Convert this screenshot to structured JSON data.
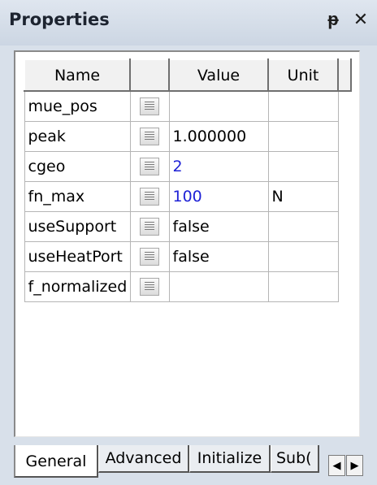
{
  "panel": {
    "title": "Properties",
    "pin_icon": "pin-icon",
    "close_icon": "close-icon",
    "pin_glyph": "ᵽ",
    "close_glyph": "✕"
  },
  "grid": {
    "columns": [
      "Name",
      "",
      "Value",
      "Unit",
      ""
    ],
    "rows": [
      {
        "name": "mue_pos",
        "value": "",
        "value_color": "#000000",
        "unit": ""
      },
      {
        "name": "peak",
        "value": "1.000000",
        "value_color": "#000000",
        "unit": ""
      },
      {
        "name": "cgeo",
        "value": "2",
        "value_color": "#1f22d6",
        "unit": ""
      },
      {
        "name": "fn_max",
        "value": "100",
        "value_color": "#1f22d6",
        "unit": "N"
      },
      {
        "name": "useSupport",
        "value": "false",
        "value_color": "#000000",
        "unit": ""
      },
      {
        "name": "useHeatPort",
        "value": "false",
        "value_color": "#000000",
        "unit": ""
      },
      {
        "name": "f_normalized",
        "value": "",
        "value_color": "#000000",
        "unit": ""
      }
    ]
  },
  "tabs": {
    "items": [
      "General",
      "Advanced",
      "Initialize",
      "Sub("
    ],
    "active": "General",
    "scroll_left": "◀",
    "scroll_right": "▶"
  }
}
